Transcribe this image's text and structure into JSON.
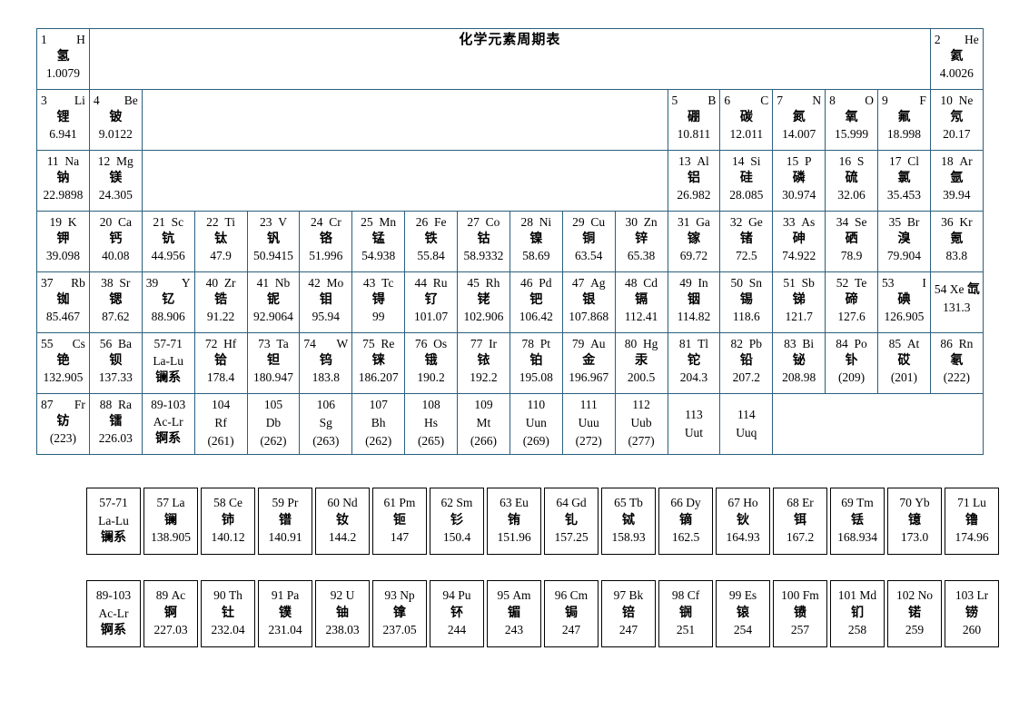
{
  "title": "化学元素周期表",
  "colors": {
    "cell_border": "#2b5f7e",
    "series_border": "#000000",
    "text": "#000000",
    "background": "#ffffff"
  },
  "labels": {
    "lanthanide_range": "57-71",
    "lanthanide_symbols": "La-Lu",
    "lanthanide_name": "镧系",
    "actinide_range": "89-103",
    "actinide_symbols": "Ac-Lr",
    "actinide_name": "锕系"
  },
  "main_rows": [
    [
      {
        "k": "e",
        "n": "1",
        "s": "H",
        "cn": "氢",
        "m": "1.0079"
      },
      {
        "k": "title"
      },
      {
        "k": "e",
        "n": "2",
        "s": "He",
        "cn": "氦",
        "m": "4.0026"
      }
    ],
    [
      {
        "k": "e",
        "n": "3",
        "s": "Li",
        "cn": "锂",
        "m": "6.941"
      },
      {
        "k": "e",
        "n": "4",
        "s": "Be",
        "cn": "铍",
        "m": "9.0122"
      },
      {
        "k": "blank",
        "span": 10
      },
      {
        "k": "e",
        "n": "5",
        "s": "B",
        "cn": "硼",
        "m": "10.811"
      },
      {
        "k": "e",
        "n": "6",
        "s": "C",
        "cn": "碳",
        "m": "12.011"
      },
      {
        "k": "e",
        "n": "7",
        "s": "N",
        "cn": "氮",
        "m": "14.007"
      },
      {
        "k": "e",
        "n": "8",
        "s": "O",
        "cn": "氧",
        "m": "15.999"
      },
      {
        "k": "e",
        "n": "9",
        "s": "F",
        "cn": "氟",
        "m": "18.998"
      },
      {
        "k": "c",
        "n": "10",
        "s": "Ne",
        "cn": "氖",
        "m": "20.17"
      }
    ],
    [
      {
        "k": "c",
        "n": "11",
        "s": "Na",
        "cn": "钠",
        "m": "22.9898"
      },
      {
        "k": "c",
        "n": "12",
        "s": "Mg",
        "cn": "镁",
        "m": "24.305"
      },
      {
        "k": "blank",
        "span": 10
      },
      {
        "k": "c",
        "n": "13",
        "s": "Al",
        "cn": "铝",
        "m": "26.982"
      },
      {
        "k": "c",
        "n": "14",
        "s": "Si",
        "cn": "硅",
        "m": "28.085"
      },
      {
        "k": "c",
        "n": "15",
        "s": "P",
        "cn": "磷",
        "m": "30.974"
      },
      {
        "k": "c",
        "n": "16",
        "s": "S",
        "cn": "硫",
        "m": "32.06"
      },
      {
        "k": "c",
        "n": "17",
        "s": "Cl",
        "cn": "氯",
        "m": "35.453"
      },
      {
        "k": "c",
        "n": "18",
        "s": "Ar",
        "cn": "氩",
        "m": "39.94"
      }
    ],
    [
      {
        "k": "c",
        "n": "19",
        "s": "K",
        "cn": "钾",
        "m": "39.098"
      },
      {
        "k": "c",
        "n": "20",
        "s": "Ca",
        "cn": "钙",
        "m": "40.08"
      },
      {
        "k": "c",
        "n": "21",
        "s": "Sc",
        "cn": "钪",
        "m": "44.956"
      },
      {
        "k": "c",
        "n": "22",
        "s": "Ti",
        "cn": "钛",
        "m": "47.9"
      },
      {
        "k": "c",
        "n": "23",
        "s": "V",
        "cn": "钒",
        "m": "50.9415"
      },
      {
        "k": "c",
        "n": "24",
        "s": "Cr",
        "cn": "铬",
        "m": "51.996"
      },
      {
        "k": "c",
        "n": "25",
        "s": "Mn",
        "cn": "锰",
        "m": "54.938"
      },
      {
        "k": "c",
        "n": "26",
        "s": "Fe",
        "cn": "铁",
        "m": "55.84"
      },
      {
        "k": "c",
        "n": "27",
        "s": "Co",
        "cn": "钴",
        "m": "58.9332"
      },
      {
        "k": "c",
        "n": "28",
        "s": "Ni",
        "cn": "镍",
        "m": "58.69"
      },
      {
        "k": "c",
        "n": "29",
        "s": "Cu",
        "cn": "铜",
        "m": "63.54"
      },
      {
        "k": "c",
        "n": "30",
        "s": "Zn",
        "cn": "锌",
        "m": "65.38"
      },
      {
        "k": "c",
        "n": "31",
        "s": "Ga",
        "cn": "镓",
        "m": "69.72"
      },
      {
        "k": "c",
        "n": "32",
        "s": "Ge",
        "cn": "锗",
        "m": "72.5"
      },
      {
        "k": "c",
        "n": "33",
        "s": "As",
        "cn": "砷",
        "m": "74.922"
      },
      {
        "k": "c",
        "n": "34",
        "s": "Se",
        "cn": "硒",
        "m": "78.9"
      },
      {
        "k": "c",
        "n": "35",
        "s": "Br",
        "cn": "溴",
        "m": "79.904"
      },
      {
        "k": "c",
        "n": "36",
        "s": "Kr",
        "cn": "氪",
        "m": "83.8"
      }
    ],
    [
      {
        "k": "e",
        "n": "37",
        "s": "Rb",
        "cn": "铷",
        "m": "85.467"
      },
      {
        "k": "c",
        "n": "38",
        "s": "Sr",
        "cn": "锶",
        "m": "87.62"
      },
      {
        "k": "e",
        "n": "39",
        "s": "Y",
        "cn": "钇",
        "m": "88.906"
      },
      {
        "k": "c",
        "n": "40",
        "s": "Zr",
        "cn": "锆",
        "m": "91.22"
      },
      {
        "k": "c",
        "n": "41",
        "s": "Nb",
        "cn": "铌",
        "m": "92.9064"
      },
      {
        "k": "c",
        "n": "42",
        "s": "Mo",
        "cn": "钼",
        "m": "95.94"
      },
      {
        "k": "c",
        "n": "43",
        "s": "Tc",
        "cn": "锝",
        "m": "99"
      },
      {
        "k": "c",
        "n": "44",
        "s": "Ru",
        "cn": "钌",
        "m": "101.07"
      },
      {
        "k": "c",
        "n": "45",
        "s": "Rh",
        "cn": "铑",
        "m": "102.906"
      },
      {
        "k": "c",
        "n": "46",
        "s": "Pd",
        "cn": "钯",
        "m": "106.42"
      },
      {
        "k": "c",
        "n": "47",
        "s": "Ag",
        "cn": "银",
        "m": "107.868"
      },
      {
        "k": "c",
        "n": "48",
        "s": "Cd",
        "cn": "镉",
        "m": "112.41"
      },
      {
        "k": "c",
        "n": "49",
        "s": "In",
        "cn": "铟",
        "m": "114.82"
      },
      {
        "k": "c",
        "n": "50",
        "s": "Sn",
        "cn": "锡",
        "m": "118.6"
      },
      {
        "k": "c",
        "n": "51",
        "s": "Sb",
        "cn": "锑",
        "m": "121.7"
      },
      {
        "k": "c",
        "n": "52",
        "s": "Te",
        "cn": "碲",
        "m": "127.6"
      },
      {
        "k": "e",
        "n": "53",
        "s": "I",
        "cn": "碘",
        "m": "126.905"
      },
      {
        "k": "ov",
        "n": "54",
        "s": "Xe",
        "cn": "氙",
        "m": "131.3"
      }
    ],
    [
      {
        "k": "e",
        "n": "55",
        "s": "Cs",
        "cn": "铯",
        "m": "132.905"
      },
      {
        "k": "c",
        "n": "56",
        "s": "Ba",
        "cn": "钡",
        "m": "137.33"
      },
      {
        "k": "ser",
        "n": "57-71",
        "s": "La-Lu",
        "cn": "镧系"
      },
      {
        "k": "c",
        "n": "72",
        "s": "Hf",
        "cn": "铪",
        "m": "178.4"
      },
      {
        "k": "c",
        "n": "73",
        "s": "Ta",
        "cn": "钽",
        "m": "180.947"
      },
      {
        "k": "e",
        "n": "74",
        "s": "W",
        "cn": "钨",
        "m": "183.8"
      },
      {
        "k": "c",
        "n": "75",
        "s": "Re",
        "cn": "铼",
        "m": "186.207"
      },
      {
        "k": "c",
        "n": "76",
        "s": "Os",
        "cn": "锇",
        "m": "190.2"
      },
      {
        "k": "c",
        "n": "77",
        "s": "Ir",
        "cn": "铱",
        "m": "192.2"
      },
      {
        "k": "c",
        "n": "78",
        "s": "Pt",
        "cn": "铂",
        "m": "195.08"
      },
      {
        "k": "c",
        "n": "79",
        "s": "Au",
        "cn": "金",
        "m": "196.967"
      },
      {
        "k": "c",
        "n": "80",
        "s": "Hg",
        "cn": "汞",
        "m": "200.5"
      },
      {
        "k": "c",
        "n": "81",
        "s": "Tl",
        "cn": "铊",
        "m": "204.3"
      },
      {
        "k": "c",
        "n": "82",
        "s": "Pb",
        "cn": "铅",
        "m": "207.2"
      },
      {
        "k": "c",
        "n": "83",
        "s": "Bi",
        "cn": "铋",
        "m": "208.98"
      },
      {
        "k": "c",
        "n": "84",
        "s": "Po",
        "cn": "钋",
        "m": "(209)"
      },
      {
        "k": "c",
        "n": "85",
        "s": "At",
        "cn": "砹",
        "m": "(201)"
      },
      {
        "k": "c",
        "n": "86",
        "s": "Rn",
        "cn": "氡",
        "m": "(222)"
      }
    ],
    [
      {
        "k": "e",
        "n": "87",
        "s": "Fr",
        "cn": "钫",
        "m": "(223)"
      },
      {
        "k": "c",
        "n": "88",
        "s": "Ra",
        "cn": "镭",
        "m": "226.03"
      },
      {
        "k": "ser",
        "n": "89-103",
        "s": "Ac-Lr",
        "cn": "锕系"
      },
      {
        "k": "t",
        "n": "104",
        "s": "Rf",
        "m": "(261)"
      },
      {
        "k": "t",
        "n": "105",
        "s": "Db",
        "m": "(262)"
      },
      {
        "k": "t",
        "n": "106",
        "s": "Sg",
        "m": "(263)"
      },
      {
        "k": "t",
        "n": "107",
        "s": "Bh",
        "m": "(262)"
      },
      {
        "k": "t",
        "n": "108",
        "s": "Hs",
        "m": "(265)"
      },
      {
        "k": "t",
        "n": "109",
        "s": "Mt",
        "m": "(266)"
      },
      {
        "k": "t",
        "n": "110",
        "s": "Uun",
        "m": "(269)"
      },
      {
        "k": "t",
        "n": "111",
        "s": "Uuu",
        "m": "(272)"
      },
      {
        "k": "t",
        "n": "112",
        "s": "Uub",
        "m": "(277)"
      },
      {
        "k": "nm",
        "n": "113",
        "s": "Uut"
      },
      {
        "k": "nm",
        "n": "114",
        "s": "Uuq"
      },
      {
        "k": "blank",
        "span": 4
      }
    ]
  ],
  "lanthanides": [
    {
      "head": true,
      "n": "57-71",
      "s": "La-Lu",
      "cn": "镧系"
    },
    {
      "n": "57",
      "s": "La",
      "cn": "镧",
      "m": "138.905"
    },
    {
      "n": "58",
      "s": "Ce",
      "cn": "铈",
      "m": "140.12"
    },
    {
      "n": "59",
      "s": "Pr",
      "cn": "镨",
      "m": "140.91"
    },
    {
      "n": "60",
      "s": "Nd",
      "cn": "钕",
      "m": "144.2"
    },
    {
      "n": "61",
      "s": "Pm",
      "cn": "钷",
      "m": "147"
    },
    {
      "n": "62",
      "s": "Sm",
      "cn": "钐",
      "m": "150.4"
    },
    {
      "n": "63",
      "s": "Eu",
      "cn": "铕",
      "m": "151.96"
    },
    {
      "n": "64",
      "s": "Gd",
      "cn": "钆",
      "m": "157.25"
    },
    {
      "n": "65",
      "s": "Tb",
      "cn": "铽",
      "m": "158.93"
    },
    {
      "n": "66",
      "s": "Dy",
      "cn": "镝",
      "m": "162.5"
    },
    {
      "n": "67",
      "s": "Ho",
      "cn": "钬",
      "m": "164.93"
    },
    {
      "n": "68",
      "s": "Er",
      "cn": "铒",
      "m": "167.2"
    },
    {
      "n": "69",
      "s": "Tm",
      "cn": "铥",
      "m": "168.934"
    },
    {
      "n": "70",
      "s": "Yb",
      "cn": "镱",
      "m": "173.0"
    },
    {
      "n": "71",
      "s": "Lu",
      "cn": "镥",
      "m": "174.96"
    }
  ],
  "actinides": [
    {
      "head": true,
      "n": "89-103",
      "s": "Ac-Lr",
      "cn": "锕系"
    },
    {
      "n": "89",
      "s": "Ac",
      "cn": "锕",
      "m": "227.03"
    },
    {
      "n": "90",
      "s": "Th",
      "cn": "钍",
      "m": "232.04"
    },
    {
      "n": "91",
      "s": "Pa",
      "cn": "镤",
      "m": "231.04"
    },
    {
      "n": "92",
      "s": "U",
      "cn": "铀",
      "m": "238.03"
    },
    {
      "n": "93",
      "s": "Np",
      "cn": "镎",
      "m": "237.05"
    },
    {
      "n": "94",
      "s": "Pu",
      "cn": "钚",
      "m": "244"
    },
    {
      "n": "95",
      "s": "Am",
      "cn": "镅",
      "m": "243"
    },
    {
      "n": "96",
      "s": "Cm",
      "cn": "锔",
      "m": "247"
    },
    {
      "n": "97",
      "s": "Bk",
      "cn": "锫",
      "m": "247"
    },
    {
      "n": "98",
      "s": "Cf",
      "cn": "锎",
      "m": "251"
    },
    {
      "n": "99",
      "s": "Es",
      "cn": "锿",
      "m": "254"
    },
    {
      "n": "100",
      "s": "Fm",
      "cn": "镄",
      "m": "257"
    },
    {
      "n": "101",
      "s": "Md",
      "cn": "钔",
      "m": "258"
    },
    {
      "n": "102",
      "s": "No",
      "cn": "锘",
      "m": "259"
    },
    {
      "n": "103",
      "s": "Lr",
      "cn": "铹",
      "m": "260"
    }
  ]
}
